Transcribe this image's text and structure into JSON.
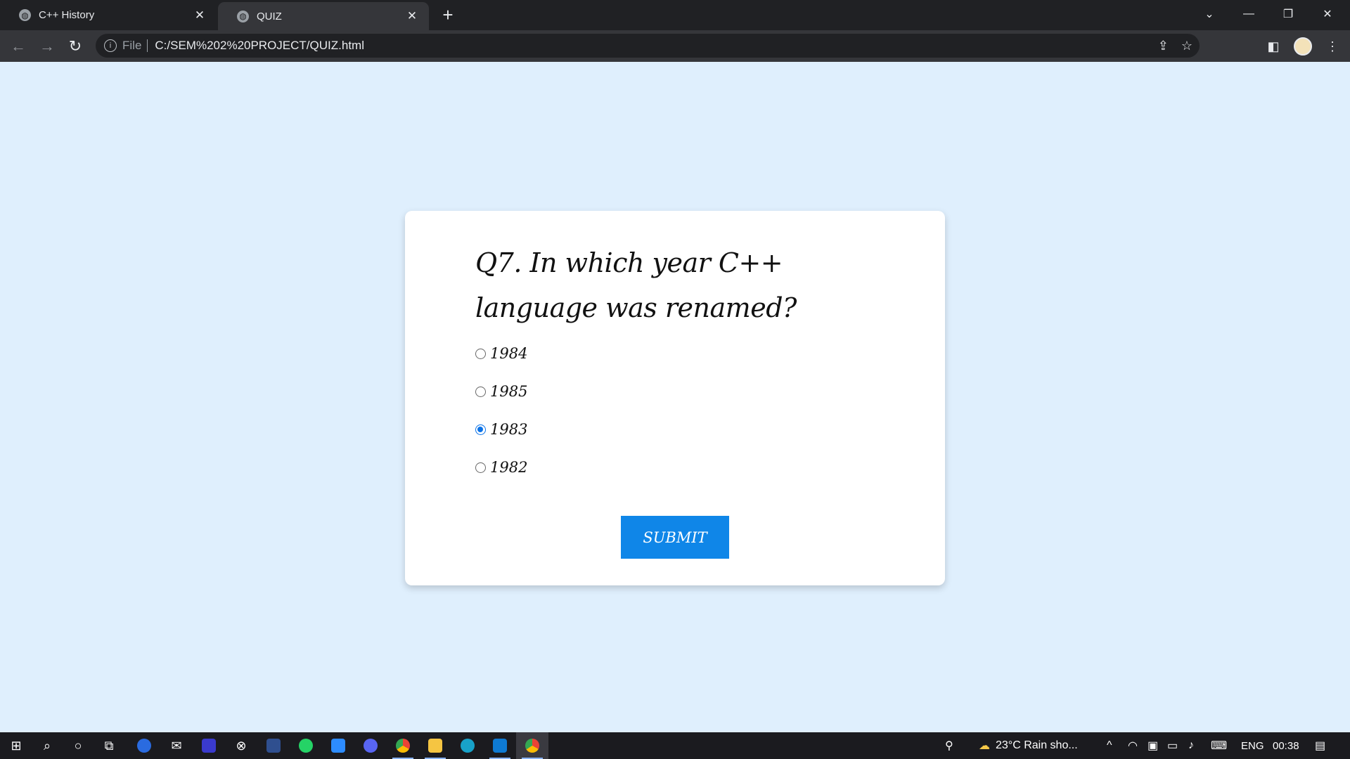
{
  "browser": {
    "tabs": [
      {
        "title": "C++ History",
        "active": false
      },
      {
        "title": "QUIZ",
        "active": true
      }
    ],
    "address": {
      "scheme": "File",
      "url": "C:/SEM%202%20PROJECT/QUIZ.html"
    }
  },
  "quiz": {
    "question": "Q7. In which year C++ language was renamed?",
    "options": [
      {
        "label": "1984",
        "checked": false
      },
      {
        "label": "1985",
        "checked": false
      },
      {
        "label": "1983",
        "checked": true
      },
      {
        "label": "1982",
        "checked": false
      }
    ],
    "submit_label": "SUBMIT"
  },
  "taskbar": {
    "weather": "23°C  Rain sho...",
    "language": "ENG",
    "time": "00:38"
  },
  "colors": {
    "page_bg": "#dfeffd",
    "accent": "#0f86e8",
    "radio_checked": "#0b72e7"
  }
}
